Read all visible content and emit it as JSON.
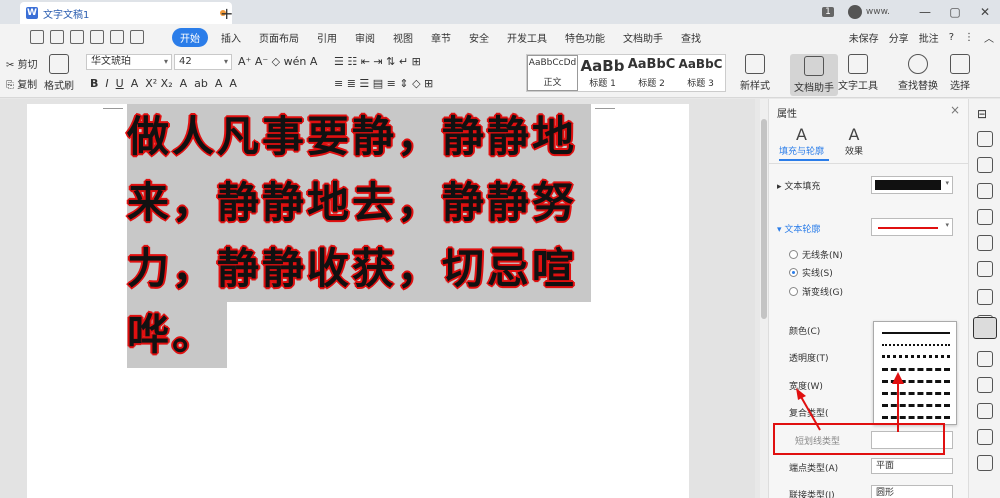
{
  "titlebar": {
    "tab_title": "文字文稿1",
    "tab_icon": "W",
    "plus": "+",
    "badge": "1",
    "user": "www.",
    "win_min": "—",
    "win_max": "▢",
    "win_close": "✕"
  },
  "menubar": {
    "items": [
      "开始",
      "插入",
      "页面布局",
      "引用",
      "审阅",
      "视图",
      "章节",
      "安全",
      "开发工具",
      "特色功能",
      "文档助手",
      "查找"
    ],
    "right": [
      "未保存",
      "分享",
      "批注",
      "?",
      "⋮",
      "︿"
    ]
  },
  "ribbon": {
    "cut": "剪切",
    "copy": "复制",
    "paint": "格式刷",
    "font_name": "华文琥珀",
    "font_size": "42",
    "styles": [
      {
        "preview": "AaBbCcDd",
        "label": "正文"
      },
      {
        "preview": "AaBb",
        "label": "标题 1"
      },
      {
        "preview": "AaBbC",
        "label": "标题 2"
      },
      {
        "preview": "AaBbC",
        "label": "标题 3"
      }
    ],
    "new_style": "新样式",
    "doc_helper": "文档助手",
    "text_tools": "文字工具",
    "find_replace": "查找替换",
    "select": "选择"
  },
  "document": {
    "lines": [
      "做人凡事要静，静静地",
      "来，静静地去，静静努",
      "力，静静收获，切忌喧",
      "哗。"
    ]
  },
  "panel": {
    "title": "属性",
    "close": "×",
    "tab_fill": "填充与轮廓",
    "tab_effect": "效果",
    "text_fill": "文本填充",
    "text_outline": "文本轮廓",
    "radio_none": "无线条(N)",
    "radio_solid": "实线(S)",
    "radio_gradient": "渐变线(G)",
    "color": "颜色(C)",
    "transparency": "透明度(T)",
    "width": "宽度(W)",
    "compound": "复合类型(",
    "dash": "短划线类型",
    "endcap": "端点类型(A)",
    "endcap_value": "平面",
    "join": "联接类型(J)",
    "join_value": "圆形"
  },
  "colors": {
    "accent": "#2b7de9",
    "outline": "#e01010",
    "fill": "#111111",
    "highlight": "#c8c8c8"
  }
}
